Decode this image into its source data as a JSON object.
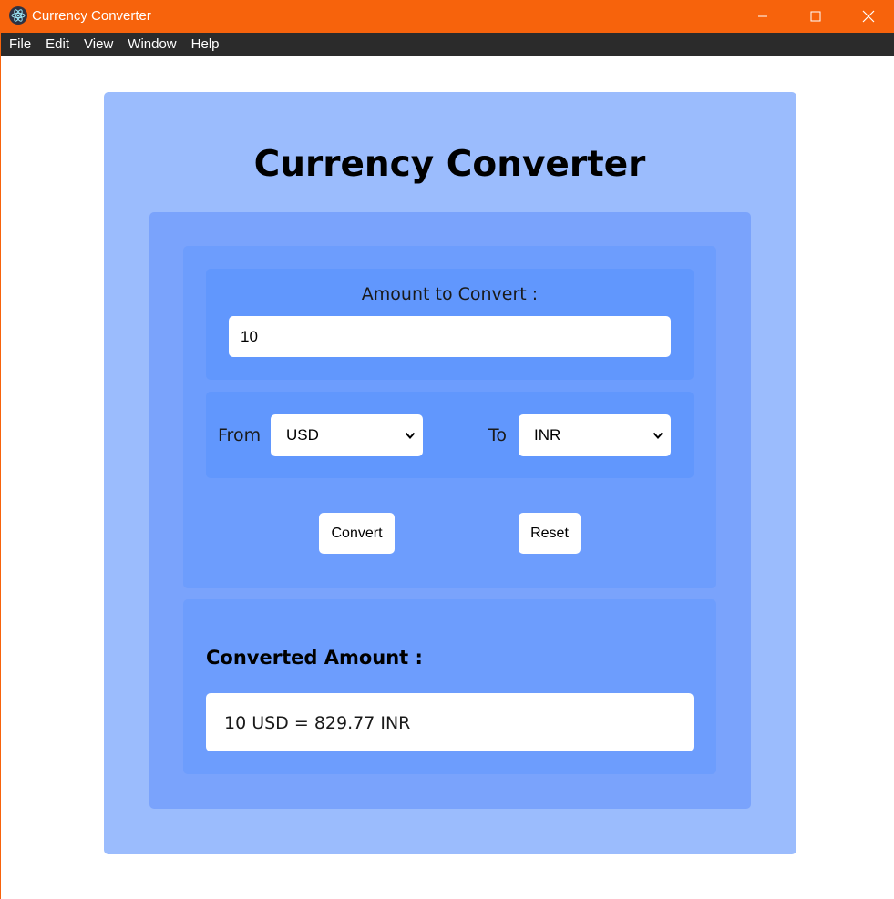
{
  "window": {
    "title": "Currency Converter",
    "app_icon": "electron-icon",
    "controls": {
      "minimize": "minimize-icon",
      "maximize": "maximize-icon",
      "close": "close-icon"
    },
    "accent_color": "#f7630c"
  },
  "menubar": {
    "items": [
      {
        "label": "File"
      },
      {
        "label": "Edit"
      },
      {
        "label": "View"
      },
      {
        "label": "Window"
      },
      {
        "label": "Help"
      }
    ]
  },
  "page": {
    "title": "Currency Converter"
  },
  "form": {
    "amount_label": "Amount to Convert :",
    "amount_value": "10",
    "from_label": "From",
    "from_value": "USD",
    "to_label": "To",
    "to_value": "INR",
    "convert_label": "Convert",
    "reset_label": "Reset"
  },
  "result": {
    "heading": "Converted Amount :",
    "text": "10 USD = 829.77 INR"
  },
  "colors": {
    "outer_card": "#9bbcfd",
    "mid_card": "#7aa3fc",
    "inner_card": "#6d9dfd",
    "section": "#6197fd",
    "menubar": "#2b2b2b"
  }
}
